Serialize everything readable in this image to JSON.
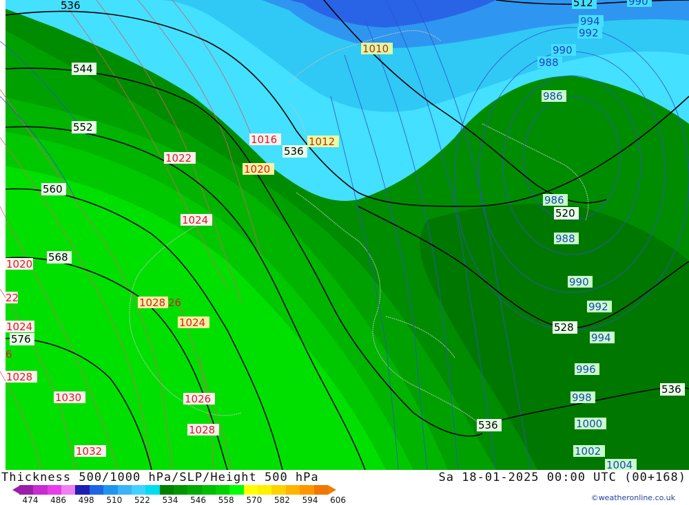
{
  "title": "Thickness 500/1000 hPa/SLP/Height 500 hPa",
  "datetime": "Sa 18-01-2025 00:00 UTC (00+168)",
  "credit": "©weatheronline.co.uk",
  "scale": {
    "ticks": [
      "474",
      "486",
      "498",
      "510",
      "522",
      "534",
      "546",
      "558",
      "570",
      "582",
      "594",
      "606"
    ],
    "colors": [
      "#9b1ea8",
      "#c82bd0",
      "#e63de8",
      "#f07ff0",
      "#1e1eb4",
      "#1e64e6",
      "#1e96f0",
      "#3cb4f5",
      "#41d2ff",
      "#00dcf0",
      "#008200",
      "#009600",
      "#00aa00",
      "#00be00",
      "#00d200",
      "#00ff00",
      "#ffff00",
      "#fff000",
      "#ffd200",
      "#ffb400",
      "#ff9600",
      "#f07800"
    ]
  },
  "labels": {
    "h536_top": "536",
    "h512": "512",
    "h544": "544",
    "h552": "552",
    "h560": "560",
    "h568": "568",
    "h576": "576",
    "h536_mid": "536",
    "h520": "520",
    "h528": "528",
    "h536_bot": "536",
    "h536_right": "536",
    "p1010": "1010",
    "p1016": "1016",
    "p1012": "1012",
    "p1020": "1020",
    "p1022": "1022",
    "p1024a": "1024",
    "p1020L": "1020",
    "p1028": "1028",
    "p1026a": "26",
    "p1024b": "1024",
    "p1024L": "1024",
    "p1028L": "1028",
    "p1030": "1030",
    "p1026": "1026",
    "p1028b": "1028",
    "p1032": "1032",
    "p22L": "22",
    "p6L": "6",
    "p994": "994",
    "p992": "992",
    "p990": "990",
    "p988": "988",
    "p986": "986",
    "p986b": "986",
    "p988b": "988",
    "p990b": "990",
    "p992b": "992",
    "p994b": "994",
    "p996": "996",
    "p998": "998",
    "p1000": "1000",
    "p1002": "1002",
    "p1004": "1004",
    "p990top": "990"
  }
}
